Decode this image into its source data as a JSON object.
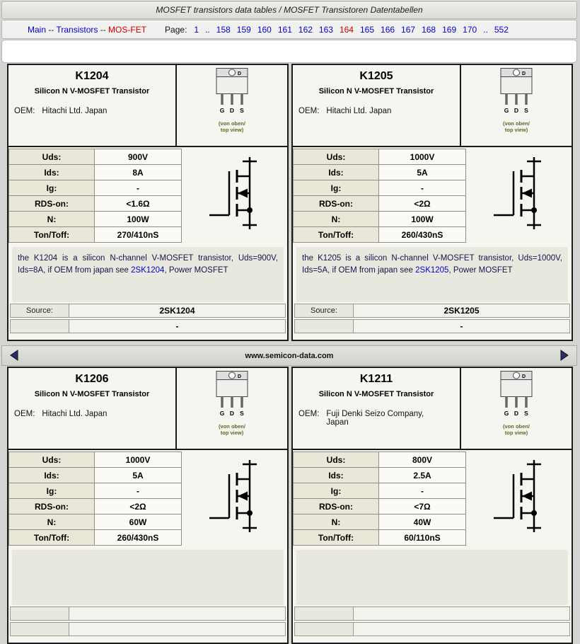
{
  "titlebar": {
    "title": "MOSFET transistors data tables / MOSFET Transistoren Datentabellen"
  },
  "nav": {
    "breadcrumb": [
      {
        "label": "Main"
      },
      {
        "label": "Transistors"
      },
      {
        "label": "MOS-FET"
      }
    ],
    "separator": "--",
    "page_label": "Page:",
    "pages": [
      "1",
      "..",
      "158",
      "159",
      "160",
      "161",
      "162",
      "163",
      "164",
      "165",
      "166",
      "167",
      "168",
      "169",
      "170",
      "..",
      "552"
    ],
    "current_page": "164"
  },
  "midbar": {
    "site": "www.semicon-data.com"
  },
  "colors": {
    "link_blue": "#0000cc",
    "current_red": "#cc0000",
    "label_beige": "#ebe7d8"
  },
  "cards": [
    {
      "title": "K1204",
      "subtitle": "Silicon N V-MOSFET Transistor",
      "oem_label": "OEM:",
      "oem_value": "Hitachi Ltd. Japan",
      "package": {
        "tab_label": "D",
        "pins": [
          "G",
          "D",
          "S"
        ],
        "note_line1": "(von oben/",
        "note_line2": "top view)"
      },
      "specs": [
        {
          "label": "Uds:",
          "value": "900V"
        },
        {
          "label": "Ids:",
          "value": "8A"
        },
        {
          "label": "Ig:",
          "value": "-"
        },
        {
          "label": "RDS-on:",
          "value": "<1.6Ω"
        },
        {
          "label": "N:",
          "value": "100W"
        },
        {
          "label": "Ton/Toff:",
          "value": "270/410nS"
        }
      ],
      "description": {
        "before": "the K1204 is a silicon N-channel V-MOSFET transistor, Uds=900V, Ids=8A, if OEM from japan see ",
        "link": "2SK1204",
        "after": ", Power MOSFET"
      },
      "source_label": "Source:",
      "source_value": "2SK1204",
      "note_value": "-"
    },
    {
      "title": "K1205",
      "subtitle": "Silicon N V-MOSFET Transistor",
      "oem_label": "OEM:",
      "oem_value": "Hitachi Ltd. Japan",
      "package": {
        "tab_label": "D",
        "pins": [
          "G",
          "D",
          "S"
        ],
        "note_line1": "(von oben/",
        "note_line2": "top view)"
      },
      "specs": [
        {
          "label": "Uds:",
          "value": "1000V"
        },
        {
          "label": "Ids:",
          "value": "5A"
        },
        {
          "label": "Ig:",
          "value": "-"
        },
        {
          "label": "RDS-on:",
          "value": "<2Ω"
        },
        {
          "label": "N:",
          "value": "100W"
        },
        {
          "label": "Ton/Toff:",
          "value": "260/430nS"
        }
      ],
      "description": {
        "before": "the K1205 is a silicon N-channel V-MOSFET transistor, Uds=1000V, Ids=5A, if OEM from japan see ",
        "link": "2SK1205",
        "after": ", Power MOSFET"
      },
      "source_label": "Source:",
      "source_value": "2SK1205",
      "note_value": "-"
    },
    {
      "title": "K1206",
      "subtitle": "Silicon N V-MOSFET Transistor",
      "oem_label": "OEM:",
      "oem_value": "Hitachi Ltd. Japan",
      "package": {
        "tab_label": "D",
        "pins": [
          "G",
          "D",
          "S"
        ],
        "note_line1": "(von oben/",
        "note_line2": "top view)"
      },
      "specs": [
        {
          "label": "Uds:",
          "value": "1000V"
        },
        {
          "label": "Ids:",
          "value": "5A"
        },
        {
          "label": "Ig:",
          "value": "-"
        },
        {
          "label": "RDS-on:",
          "value": "<2Ω"
        },
        {
          "label": "N:",
          "value": "60W"
        },
        {
          "label": "Ton/Toff:",
          "value": "260/430nS"
        }
      ],
      "description": {
        "before": "",
        "link": "",
        "after": ""
      },
      "source_label": "",
      "source_value": "",
      "note_value": ""
    },
    {
      "title": "K1211",
      "subtitle": "Silicon N V-MOSFET Transistor",
      "oem_label": "OEM:",
      "oem_value": "Fuji Denki Seizo Company, Japan",
      "package": {
        "tab_label": "D",
        "pins": [
          "G",
          "D",
          "S"
        ],
        "note_line1": "(von oben/",
        "note_line2": "top view)"
      },
      "specs": [
        {
          "label": "Uds:",
          "value": "800V"
        },
        {
          "label": "Ids:",
          "value": "2.5A"
        },
        {
          "label": "Ig:",
          "value": "-"
        },
        {
          "label": "RDS-on:",
          "value": "<7Ω"
        },
        {
          "label": "N:",
          "value": "40W"
        },
        {
          "label": "Ton/Toff:",
          "value": "60/110nS"
        }
      ],
      "description": {
        "before": "",
        "link": "",
        "after": ""
      },
      "source_label": "",
      "source_value": "",
      "note_value": ""
    }
  ]
}
